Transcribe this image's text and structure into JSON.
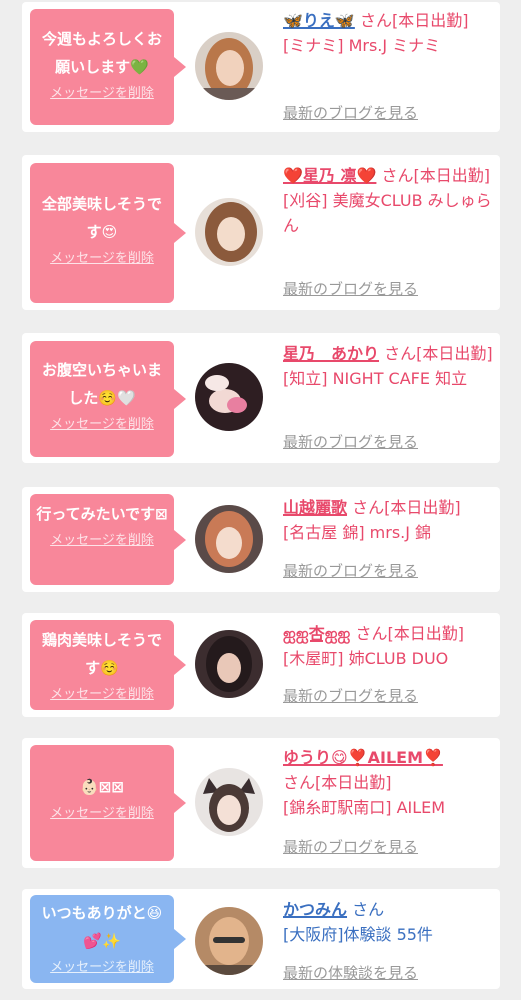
{
  "items": [
    {
      "message": "今週もよろしくお願いします💚",
      "delete_label": "メッセージを削除",
      "name": "🦋りえ🦋",
      "san": "さん",
      "status": "[本日出勤]",
      "shop": "[ミナミ] Mrs.J ミナミ",
      "link": "最新のブログを見る"
    },
    {
      "message": "全部美味しそうです😍",
      "delete_label": "メッセージを削除",
      "name": "❤️星乃 凛❤️",
      "san": "さん",
      "status": "[本日出勤]",
      "shop": "[刈谷] 美魔女CLUB みしゅらん",
      "link": "最新のブログを見る"
    },
    {
      "message": "お腹空いちゃいました☺️🤍",
      "delete_label": "メッセージを削除",
      "name": "星乃　あかり",
      "san": "さん",
      "status": "[本日出勤]",
      "shop": "[知立] NIGHT CAFE 知立",
      "link": "最新のブログを見る"
    },
    {
      "message": "行ってみたいです⊠",
      "delete_label": "メッセージを削除",
      "name": "山越麗歌",
      "san": "さん",
      "status": "[本日出勤]",
      "shop": "[名古屋 錦] mrs.J 錦",
      "link": "最新のブログを見る"
    },
    {
      "message": "鶏肉美味しそうです☺️",
      "delete_label": "メッセージを削除",
      "name": "ஐஐ杏ஐஐ",
      "san": "さん",
      "status": "[本日出勤]",
      "shop": "[木屋町] 姉CLUB DUO",
      "link": "最新のブログを見る"
    },
    {
      "message": "👶🏻⊠⊠",
      "delete_label": "メッセージを削除",
      "name": "ゆうり😋❣️AILEM❣️",
      "san": "さん",
      "status": "[本日出勤]",
      "shop": "[錦糸町駅南口] AILEM",
      "link": "最新のブログを見る"
    },
    {
      "message": "いつもありがと😆💕✨",
      "delete_label": "メッセージを削除",
      "name": "かつみん",
      "san": "さん",
      "status": "",
      "shop": "[大阪府]体験談 55件",
      "link": "最新の体験談を見る"
    }
  ],
  "colors": {
    "pink_bubble": "#f8879a",
    "blue_bubble": "#8ab6f1",
    "pink_text": "#e8496b",
    "blue_text": "#3a6fc0",
    "link_gray": "#999999"
  },
  "avatar_icons": [
    "woman-photo",
    "woman-photo",
    "hands-photo",
    "woman-photo",
    "woman-photo",
    "cat-ears-photo",
    "man-photo"
  ]
}
